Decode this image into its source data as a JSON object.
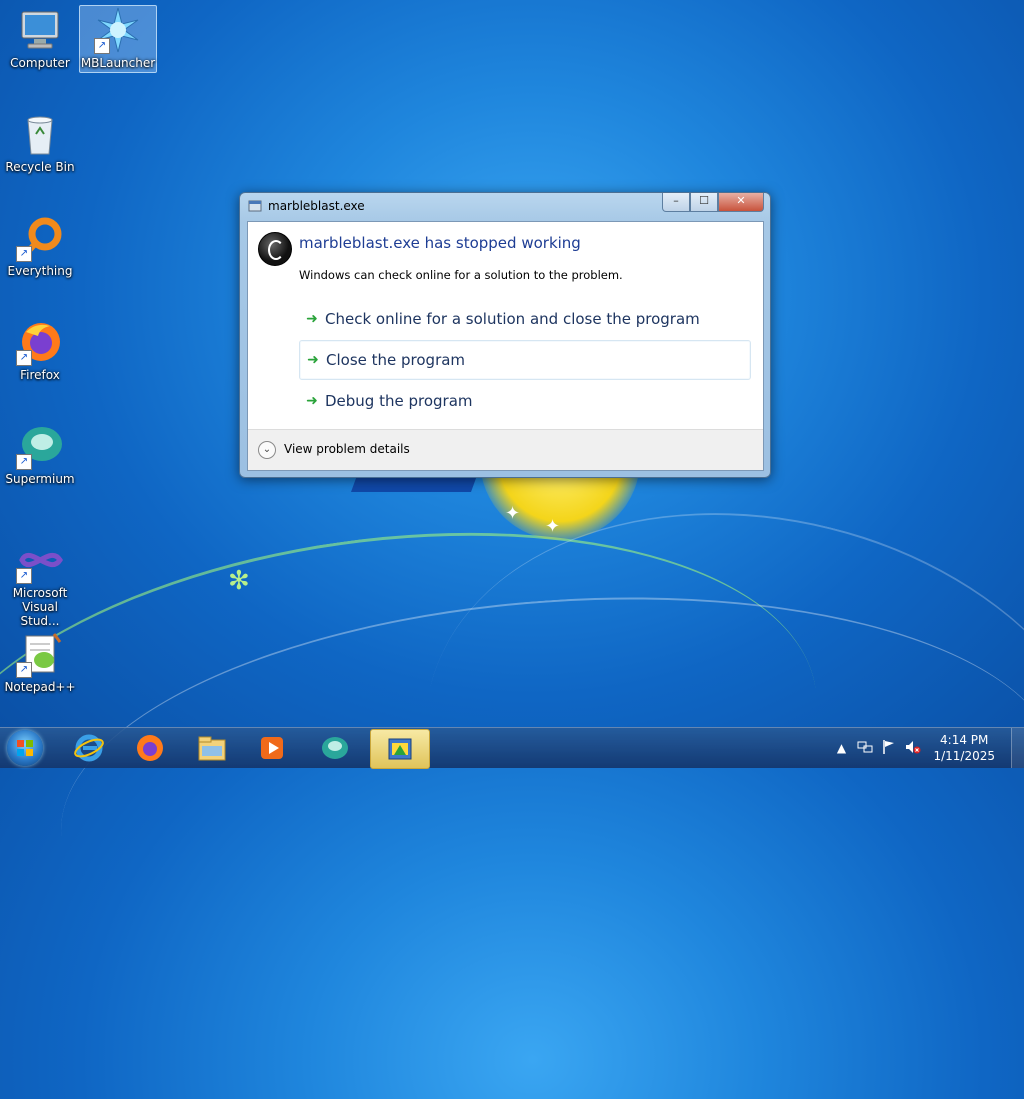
{
  "desktop": {
    "icons": [
      {
        "label": "Computer"
      },
      {
        "label": "MBLauncher"
      },
      {
        "label": "Recycle Bin"
      },
      {
        "label": "Everything"
      },
      {
        "label": "Firefox"
      },
      {
        "label": "Supermium"
      },
      {
        "label": "Microsoft Visual Stud..."
      },
      {
        "label": "Notepad++"
      }
    ]
  },
  "dialog": {
    "title": "marbleblast.exe",
    "heading": "marbleblast.exe has stopped working",
    "subtext": "Windows can check online for a solution to the problem.",
    "options": [
      {
        "label": "Check online for a solution and close the program"
      },
      {
        "label": "Close the program"
      },
      {
        "label": "Debug the program"
      }
    ],
    "details_label": "View problem details",
    "controls": {
      "minimize": "–",
      "maximize": "☐",
      "close": "✕"
    }
  },
  "taskbar": {
    "items": [
      "internet-explorer",
      "firefox",
      "file-explorer",
      "media-player",
      "supermium",
      "marbleblast"
    ],
    "clock_time": "4:14 PM",
    "clock_date": "1/11/2025"
  }
}
